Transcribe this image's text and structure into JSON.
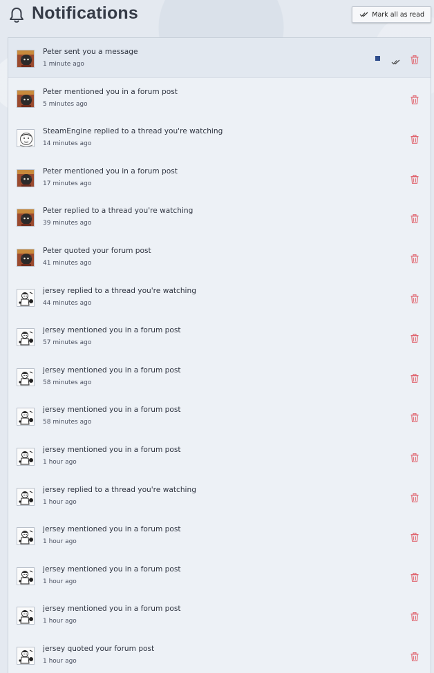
{
  "header": {
    "title": "Notifications",
    "mark_all_label": "Mark all as read"
  },
  "colors": {
    "unread_marker": "#2f4d8c",
    "delete_icon": "#e0656f",
    "panel_bg": "#edf1f6",
    "unread_row_bg": "#e2e8f0"
  },
  "notifications": [
    {
      "text": "Peter sent you a message",
      "time": "1 minute ago",
      "avatar": "peter",
      "unread": true
    },
    {
      "text": "Peter mentioned you in a forum post",
      "time": "5 minutes ago",
      "avatar": "peter",
      "unread": false
    },
    {
      "text": "SteamEngine replied to a thread you're watching",
      "time": "14 minutes ago",
      "avatar": "steamengine",
      "unread": false
    },
    {
      "text": "Peter mentioned you in a forum post",
      "time": "17 minutes ago",
      "avatar": "peter",
      "unread": false
    },
    {
      "text": "Peter replied to a thread you're watching",
      "time": "39 minutes ago",
      "avatar": "peter",
      "unread": false
    },
    {
      "text": "Peter quoted your forum post",
      "time": "41 minutes ago",
      "avatar": "peter",
      "unread": false
    },
    {
      "text": "jersey replied to a thread you're watching",
      "time": "44 minutes ago",
      "avatar": "jersey",
      "unread": false
    },
    {
      "text": "jersey mentioned you in a forum post",
      "time": "57 minutes ago",
      "avatar": "jersey",
      "unread": false
    },
    {
      "text": "jersey mentioned you in a forum post",
      "time": "58 minutes ago",
      "avatar": "jersey",
      "unread": false
    },
    {
      "text": "jersey mentioned you in a forum post",
      "time": "58 minutes ago",
      "avatar": "jersey",
      "unread": false
    },
    {
      "text": "jersey mentioned you in a forum post",
      "time": "1 hour ago",
      "avatar": "jersey",
      "unread": false
    },
    {
      "text": "jersey replied to a thread you're watching",
      "time": "1 hour ago",
      "avatar": "jersey",
      "unread": false
    },
    {
      "text": "jersey mentioned you in a forum post",
      "time": "1 hour ago",
      "avatar": "jersey",
      "unread": false
    },
    {
      "text": "jersey mentioned you in a forum post",
      "time": "1 hour ago",
      "avatar": "jersey",
      "unread": false
    },
    {
      "text": "jersey mentioned you in a forum post",
      "time": "1 hour ago",
      "avatar": "jersey",
      "unread": false
    },
    {
      "text": "jersey quoted your forum post",
      "time": "1 hour ago",
      "avatar": "jersey",
      "unread": false
    }
  ]
}
